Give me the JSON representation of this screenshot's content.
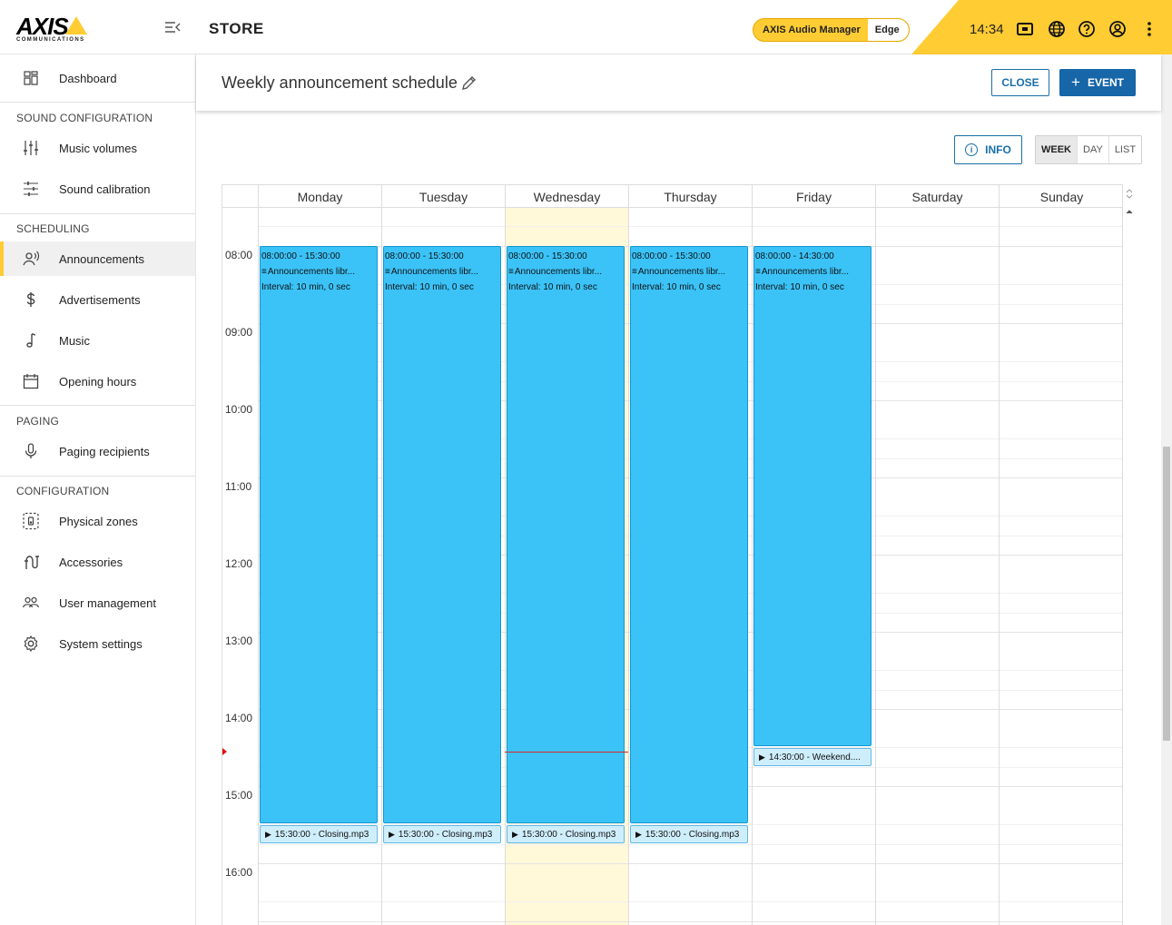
{
  "header": {
    "store_title": "STORE",
    "product_name": "AXIS Audio Manager",
    "product_edition": "Edge",
    "clock": "14:34",
    "logo_text": "AXIS",
    "logo_subtext": "COMMUNICATIONS",
    "icons": [
      "menu-collapse-icon",
      "display-icon",
      "globe-icon",
      "help-icon",
      "account-icon",
      "more-vert-icon"
    ]
  },
  "sidebar": {
    "dashboard": "Dashboard",
    "sections": {
      "sound": "SOUND CONFIGURATION",
      "scheduling": "SCHEDULING",
      "paging": "PAGING",
      "configuration": "CONFIGURATION"
    },
    "items": {
      "music_volumes": "Music volumes",
      "sound_calibration": "Sound calibration",
      "announcements": "Announcements",
      "advertisements": "Advertisements",
      "music": "Music",
      "opening_hours": "Opening hours",
      "paging_recipients": "Paging recipients",
      "physical_zones": "Physical zones",
      "accessories": "Accessories",
      "user_management": "User management",
      "system_settings": "System settings"
    },
    "active": "announcements"
  },
  "page": {
    "title": "Weekly announcement schedule",
    "close_label": "CLOSE",
    "event_label": "EVENT",
    "info_label": "INFO",
    "views": [
      "WEEK",
      "DAY",
      "LIST"
    ],
    "selected_view": "WEEK"
  },
  "calendar": {
    "days": [
      "Monday",
      "Tuesday",
      "Wednesday",
      "Thursday",
      "Friday",
      "Saturday",
      "Sunday"
    ],
    "today": "Wednesday",
    "times": [
      "08:00",
      "09:00",
      "10:00",
      "11:00",
      "12:00",
      "13:00",
      "14:00",
      "15:00",
      "16:00"
    ],
    "current_time": "14:34",
    "events": [
      {
        "day": "Monday",
        "time": "08:00:00 - 15:30:00",
        "source": "Announcements libr...",
        "interval": "Interval: 10 min, 0 sec"
      },
      {
        "day": "Tuesday",
        "time": "08:00:00 - 15:30:00",
        "source": "Announcements libr...",
        "interval": "Interval: 10 min, 0 sec"
      },
      {
        "day": "Wednesday",
        "time": "08:00:00 - 15:30:00",
        "source": "Announcements libr...",
        "interval": "Interval: 10 min, 0 sec"
      },
      {
        "day": "Thursday",
        "time": "08:00:00 - 15:30:00",
        "source": "Announcements libr...",
        "interval": "Interval: 10 min, 0 sec"
      },
      {
        "day": "Friday",
        "time": "08:00:00 - 14:30:00",
        "source": "Announcements libr...",
        "interval": "Interval: 10 min, 0 sec"
      }
    ],
    "triggers": [
      {
        "day": "Monday",
        "label": "15:30:00 - Closing.mp3"
      },
      {
        "day": "Tuesday",
        "label": "15:30:00 - Closing.mp3"
      },
      {
        "day": "Wednesday",
        "label": "15:30:00 - Closing.mp3"
      },
      {
        "day": "Thursday",
        "label": "15:30:00 - Closing.mp3"
      },
      {
        "day": "Friday",
        "label": "14:30:00 - Weekend...."
      }
    ]
  },
  "colors": {
    "accent": "#ffcc33",
    "primary": "#1666a8",
    "event": "#3bc3f8",
    "today": "#fff8d9",
    "now": "#d32a2a"
  }
}
